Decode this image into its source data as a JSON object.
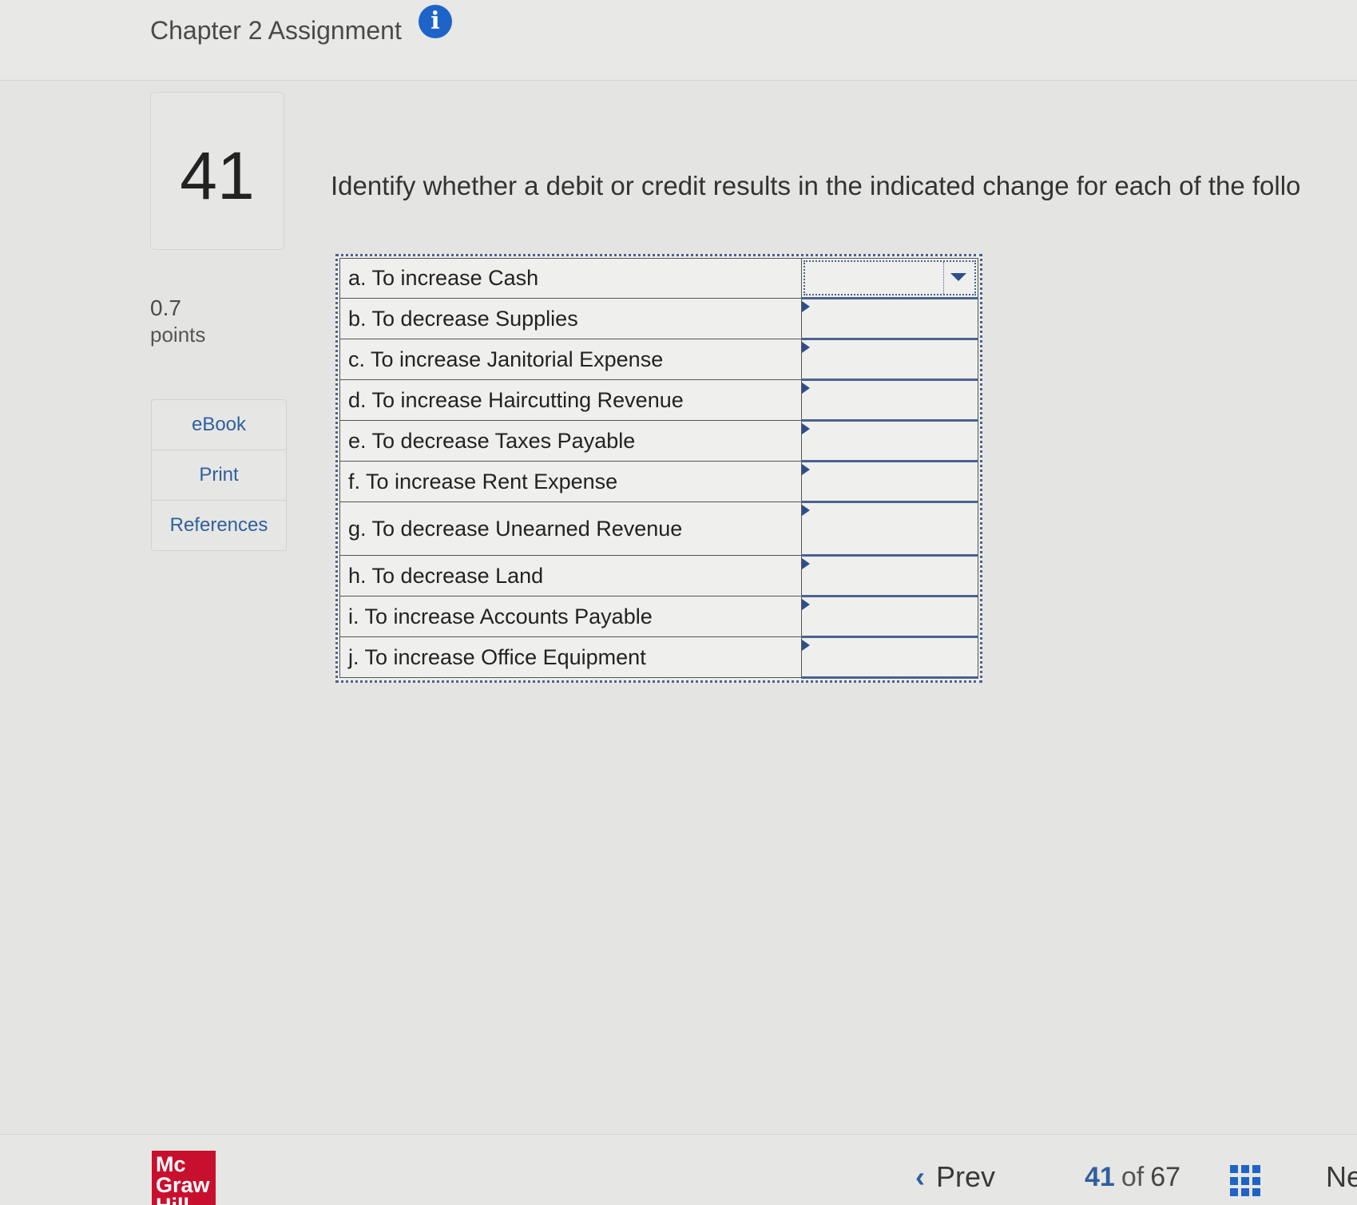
{
  "header": {
    "title": "Chapter 2 Assignment",
    "info_icon": "i"
  },
  "question": {
    "number": "41",
    "points_value": "0.7",
    "points_label": "points",
    "prompt": "Identify whether a debit or credit results in the indicated change for each of the follo"
  },
  "tools": [
    {
      "label": "eBook"
    },
    {
      "label": "Print"
    },
    {
      "label": "References"
    }
  ],
  "rows": [
    {
      "label": "a. To increase Cash",
      "answer": ""
    },
    {
      "label": "b. To decrease Supplies",
      "answer": ""
    },
    {
      "label": "c. To increase Janitorial Expense",
      "answer": ""
    },
    {
      "label": "d. To increase Haircutting Revenue",
      "answer": ""
    },
    {
      "label": "e. To decrease Taxes Payable",
      "answer": ""
    },
    {
      "label": "f. To increase Rent Expense",
      "answer": ""
    },
    {
      "label": "g. To decrease Unearned Revenue",
      "answer": ""
    },
    {
      "label": "h. To decrease Land",
      "answer": ""
    },
    {
      "label": "i. To increase Accounts Payable",
      "answer": ""
    },
    {
      "label": "j. To increase Office Equipment",
      "answer": ""
    }
  ],
  "footer": {
    "logo_text": "Mc Graw Hill",
    "prev_label": "Prev",
    "current_page": "41",
    "of_label": "of",
    "total_pages": "67",
    "next_label": "Ne"
  },
  "colors": {
    "accent": "#1e64c8",
    "link": "#2f5f9e",
    "logo": "#c8102e"
  }
}
